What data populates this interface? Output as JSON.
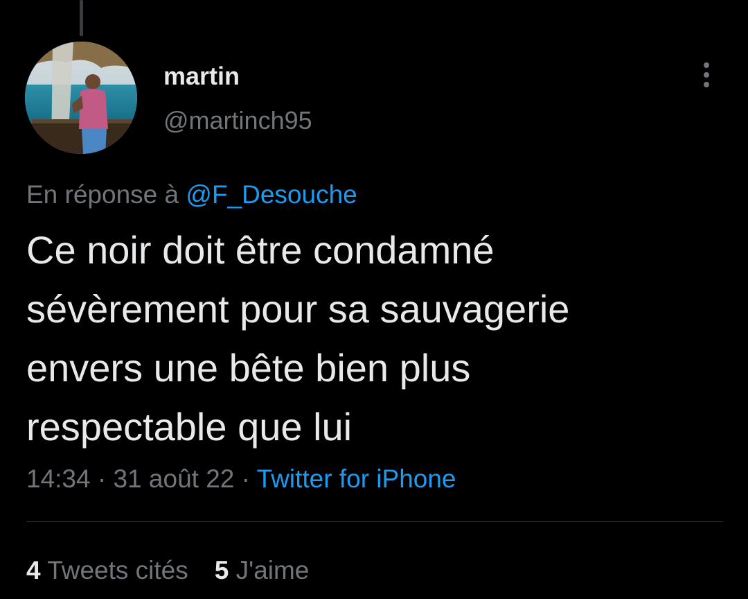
{
  "author": {
    "display_name": "martin",
    "handle": "@martinch95"
  },
  "tweet": {
    "reply_prefix": "En réponse à ",
    "reply_mention": "@F_Desouche",
    "text_lines": [
      "Ce noir doit être condamné",
      "sévèrement pour sa sauvagerie",
      "envers une bête bien plus",
      "respectable que lui"
    ],
    "time": "14:34",
    "separator": " · ",
    "date": "31 août 22",
    "source": "Twitter for iPhone"
  },
  "stats": {
    "quote_count": "4",
    "quote_label": " Tweets cités",
    "like_count": "5",
    "like_label": " J'aime"
  },
  "icons": {
    "more": "more-vertical-icon",
    "avatar": "profile-photo"
  },
  "colors": {
    "background": "#000000",
    "text_primary": "#e7e9ea",
    "text_secondary": "#71767b",
    "accent": "#1d9bf0",
    "divider": "#2f3336"
  }
}
